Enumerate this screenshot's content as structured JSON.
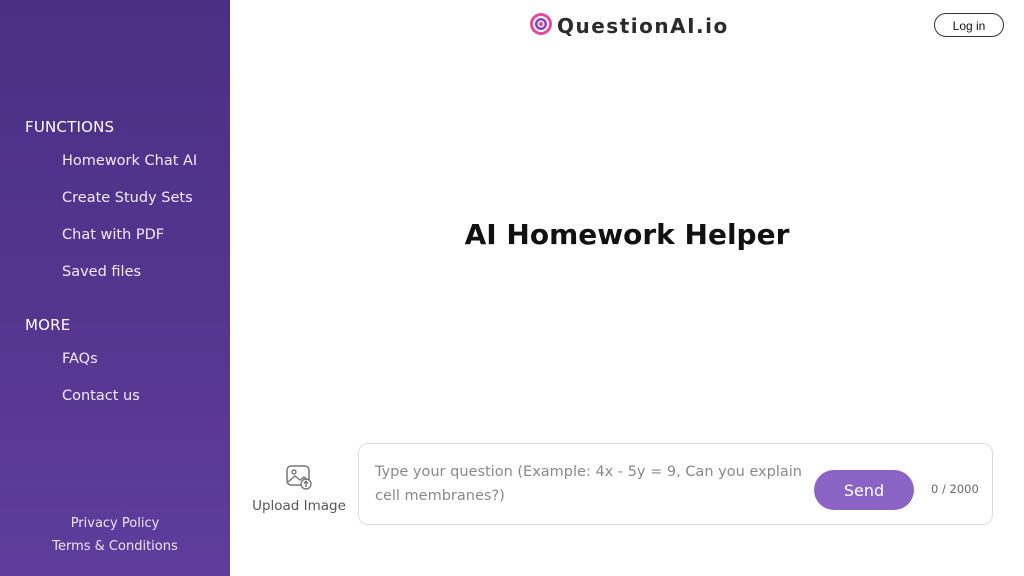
{
  "brand": {
    "name": "QuestionAI.io",
    "colors": {
      "sidebar": "#4f3289",
      "accent": "#8b63c4"
    }
  },
  "header": {
    "login_label": "Log in"
  },
  "sidebar": {
    "functions_title": "FUNCTIONS",
    "functions": [
      "Homework Chat AI",
      "Create Study Sets",
      "Chat with PDF",
      "Saved files"
    ],
    "more_title": "MORE",
    "more": [
      "FAQs",
      "Contact us"
    ],
    "footer": [
      "Privacy Policy",
      "Terms & Conditions"
    ]
  },
  "main": {
    "headline": "AI Homework Helper",
    "upload": {
      "icon": "image-upload-icon",
      "label": "Upload Image"
    },
    "input": {
      "placeholder": "Type your question (Example: 4x - 5y = 9, Can you explain cell membranes?)",
      "value": ""
    },
    "send_label": "Send",
    "counter": "0 / 2000"
  }
}
